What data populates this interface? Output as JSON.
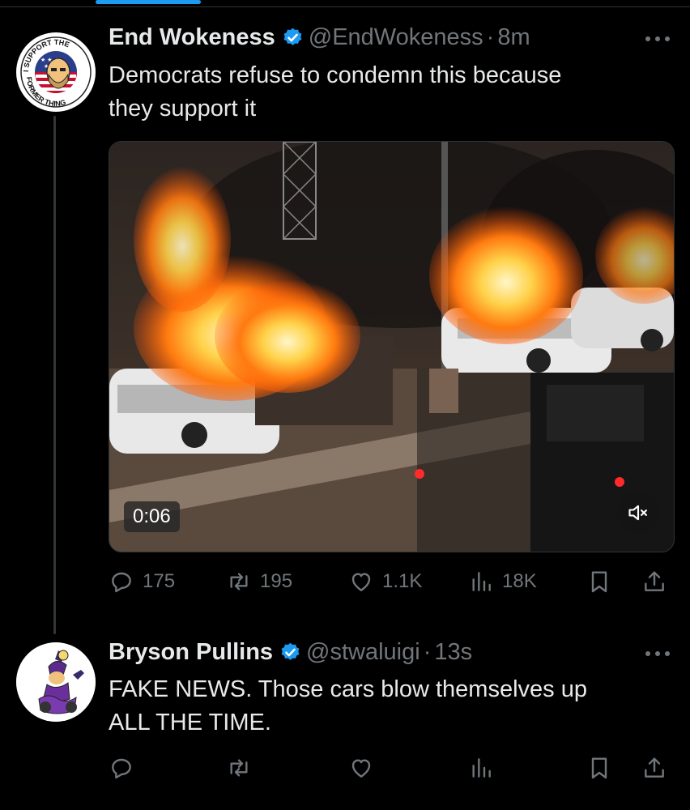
{
  "tweets": [
    {
      "name": "End Wokeness",
      "handle": "@EndWokeness",
      "time": "8m",
      "text_lines": [
        "Democrats refuse to condemn this because",
        "they support it"
      ],
      "avatar": {
        "text_top": "I SUPPORT THE",
        "text_bottom": "FORMER THING"
      },
      "media": {
        "type": "video",
        "timestamp": "0:06",
        "muted": true
      },
      "stats": {
        "replies": "175",
        "reposts": "195",
        "likes": "1.1K",
        "views": "18K"
      }
    },
    {
      "name": "Bryson Pullins",
      "handle": "@stwaluigi",
      "time": "13s",
      "text_lines": [
        "FAKE NEWS. Those cars blow themselves up",
        "ALL THE TIME."
      ],
      "stats": {
        "replies": "",
        "reposts": "",
        "likes": "",
        "views": ""
      }
    }
  ],
  "separator": "·",
  "colors": {
    "accent": "#1d9bf0",
    "background": "#000000",
    "muted_text": "#71767b"
  },
  "icons": [
    "verified-badge-icon",
    "more-icon",
    "reply-icon",
    "repost-icon",
    "like-icon",
    "views-icon",
    "bookmark-icon",
    "share-icon",
    "mute-icon"
  ]
}
